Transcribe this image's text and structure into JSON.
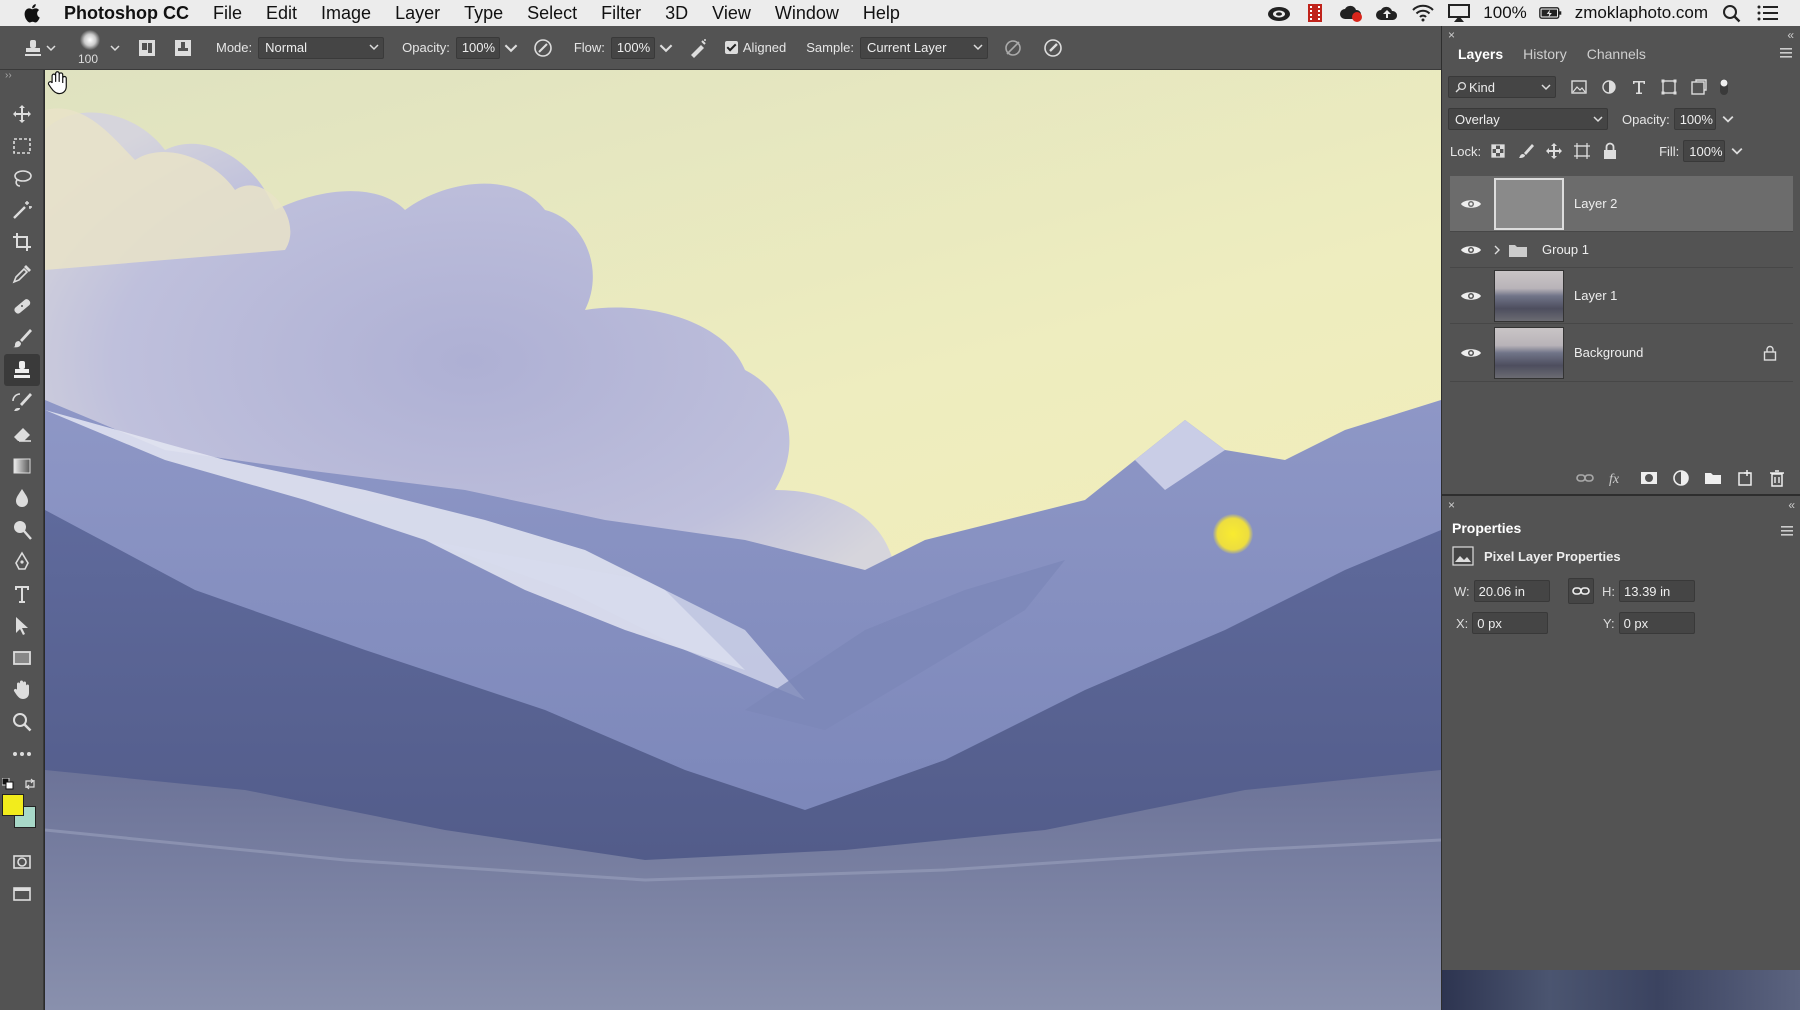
{
  "menubar": {
    "app": "Photoshop CC",
    "items": [
      "File",
      "Edit",
      "Image",
      "Layer",
      "Type",
      "Select",
      "Filter",
      "3D",
      "View",
      "Window",
      "Help"
    ],
    "battery": "100%",
    "domain": "zmoklaphoto.com"
  },
  "options": {
    "brush_size": "100",
    "mode_label": "Mode:",
    "mode_value": "Normal",
    "opacity_label": "Opacity:",
    "opacity_value": "100%",
    "flow_label": "Flow:",
    "flow_value": "100%",
    "aligned_label": "Aligned",
    "aligned_checked": true,
    "sample_label": "Sample:",
    "sample_value": "Current Layer"
  },
  "toolbar": {
    "tools": [
      "move-tool",
      "marquee-tool",
      "lasso-tool",
      "magic-wand-tool",
      "crop-tool",
      "eyedropper-tool",
      "healing-brush-tool",
      "brush-tool",
      "clone-stamp-tool",
      "history-brush-tool",
      "eraser-tool",
      "gradient-tool",
      "blur-tool",
      "dodge-tool",
      "pen-tool",
      "type-tool",
      "path-selection-tool",
      "rectangle-tool",
      "hand-tool",
      "zoom-tool",
      "more-tools"
    ],
    "active_tool": "clone-stamp-tool",
    "foreground_color": "#f2ec1c",
    "background_color": "#a8d8c8"
  },
  "layers_panel": {
    "tabs": [
      "Layers",
      "History",
      "Channels"
    ],
    "active_tab": "Layers",
    "filter_label": "Kind",
    "blend_mode": "Overlay",
    "opacity_label": "Opacity:",
    "opacity_value": "100%",
    "lock_label": "Lock:",
    "fill_label": "Fill:",
    "fill_value": "100%",
    "layers": [
      {
        "name": "Layer 2",
        "type": "pixel",
        "selected": true,
        "visible": true
      },
      {
        "name": "Group 1",
        "type": "group",
        "selected": false,
        "visible": true
      },
      {
        "name": "Layer 1",
        "type": "pixel",
        "selected": false,
        "visible": true
      },
      {
        "name": "Background",
        "type": "pixel",
        "selected": false,
        "visible": true,
        "locked": true
      }
    ]
  },
  "properties_panel": {
    "title": "Properties",
    "subtitle": "Pixel Layer Properties",
    "w_label": "W:",
    "w_value": "20.06 in",
    "h_label": "H:",
    "h_value": "13.39 in",
    "x_label": "X:",
    "x_value": "0 px",
    "y_label": "Y:",
    "y_value": "0 px"
  }
}
